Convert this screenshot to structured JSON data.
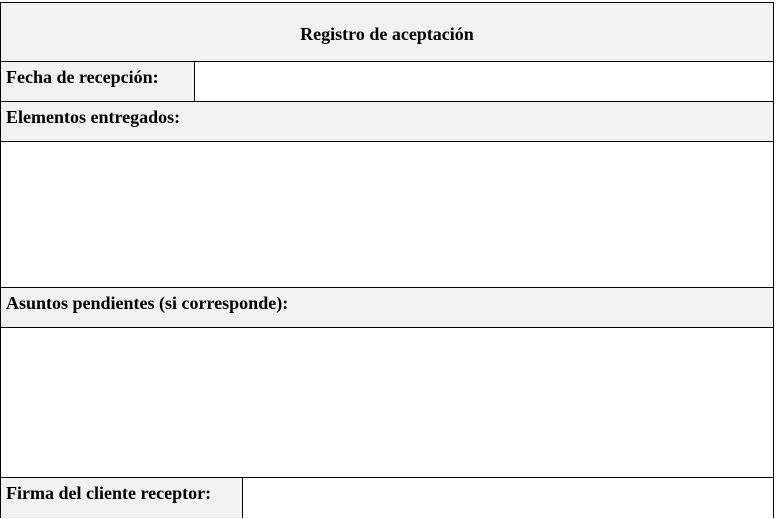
{
  "form": {
    "title": "Registro de aceptación",
    "fecha_label": "Fecha de recepción:",
    "fecha_value": "",
    "elementos_label": "Elementos entregados:",
    "elementos_value": "",
    "asuntos_label": "Asuntos pendientes (si corresponde):",
    "asuntos_value": "",
    "firma_label": "Firma del cliente receptor:",
    "firma_value": ""
  },
  "colors": {
    "header_fill": "#f2f2f2",
    "border": "#000000",
    "text": "#000000"
  }
}
